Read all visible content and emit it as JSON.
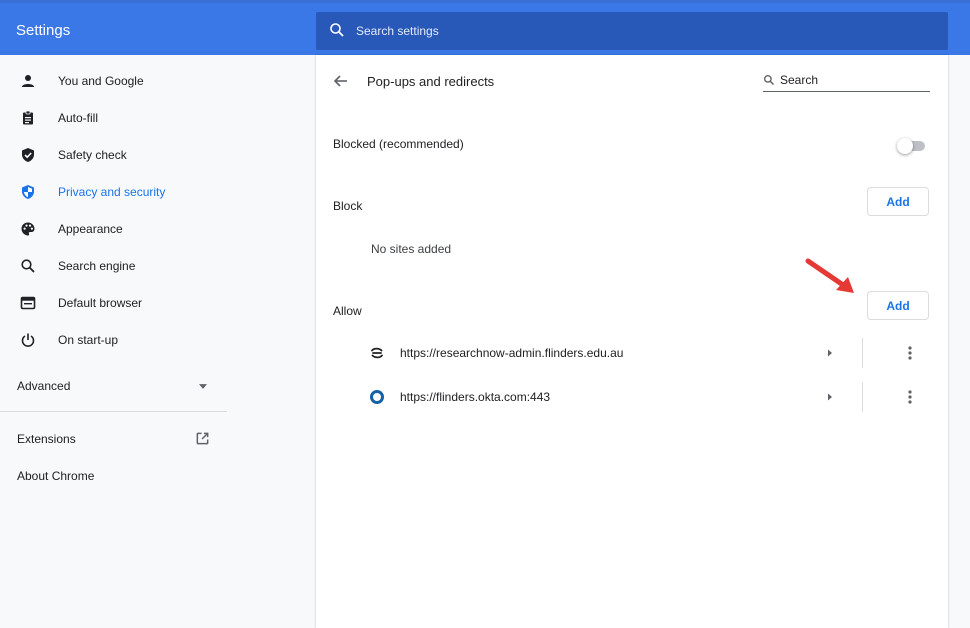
{
  "header": {
    "title": "Settings",
    "search_placeholder": "Search settings"
  },
  "sidebar": {
    "items": [
      {
        "label": "You and Google",
        "icon": "person-icon"
      },
      {
        "label": "Auto-fill",
        "icon": "clipboard-icon"
      },
      {
        "label": "Safety check",
        "icon": "shield-check-icon"
      },
      {
        "label": "Privacy and security",
        "icon": "shield-icon",
        "active": true
      },
      {
        "label": "Appearance",
        "icon": "palette-icon"
      },
      {
        "label": "Search engine",
        "icon": "search-icon"
      },
      {
        "label": "Default browser",
        "icon": "browser-window-icon"
      },
      {
        "label": "On start-up",
        "icon": "power-icon"
      }
    ],
    "advanced_label": "Advanced",
    "extensions_label": "Extensions",
    "about_label": "About Chrome"
  },
  "page": {
    "title": "Pop-ups and redirects",
    "search_placeholder": "Search",
    "blocked_label": "Blocked (recommended)",
    "blocked_toggle_on": false,
    "block_section": {
      "heading": "Block",
      "add_label": "Add",
      "empty_text": "No sites added"
    },
    "allow_section": {
      "heading": "Allow",
      "add_label": "Add",
      "sites": [
        {
          "url": "https://researchnow-admin.flinders.edu.au",
          "icon": "researchnow-favicon-icon"
        },
        {
          "url": "https://flinders.okta.com:443",
          "icon": "okta-favicon-icon"
        }
      ]
    }
  },
  "colors": {
    "header_bg": "#3b78e7",
    "search_bg": "#2858b8",
    "accent": "#1a73e8",
    "arrow": "#e53935"
  }
}
